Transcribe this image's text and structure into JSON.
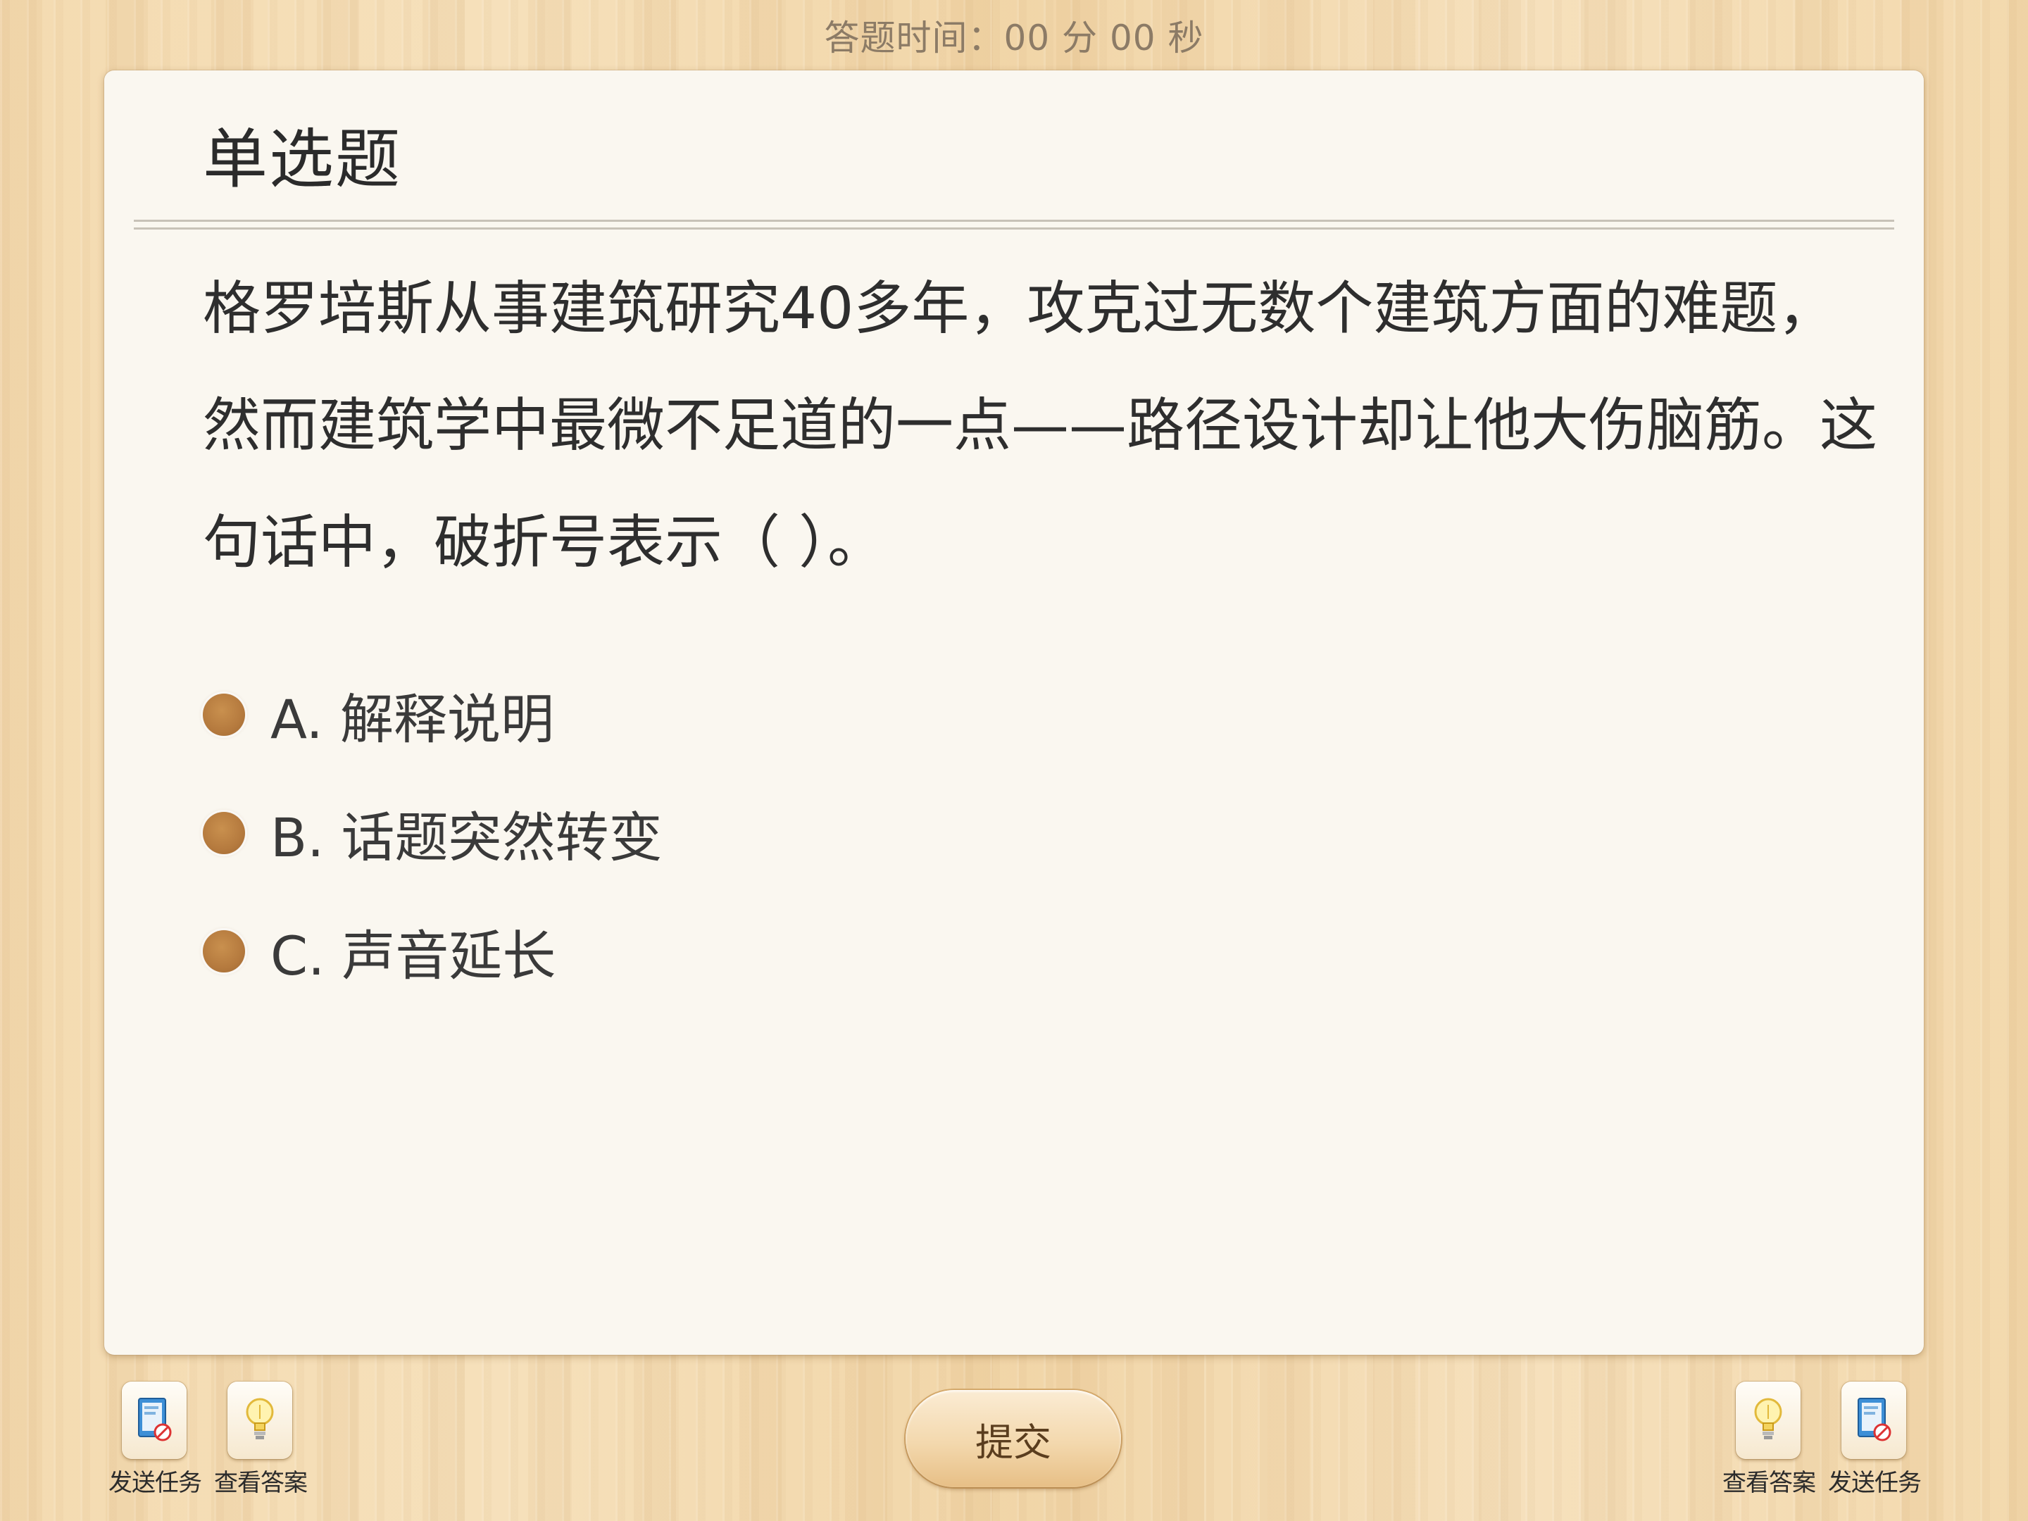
{
  "timer": {
    "label": "答题时间：",
    "minutes": "00",
    "minutes_unit": "分",
    "seconds": "00",
    "seconds_unit": "秒"
  },
  "question": {
    "type": "单选题",
    "text": "格罗培斯从事建筑研究40多年，攻克过无数个建筑方面的难题，然而建筑学中最微不足道的一点——路径设计却让他大伤脑筋。这句话中，破折号表示（ ）。",
    "options": [
      {
        "letter": "A.",
        "text": "解释说明"
      },
      {
        "letter": "B.",
        "text": "话题突然转变"
      },
      {
        "letter": "C.",
        "text": "声音延长"
      }
    ]
  },
  "footer": {
    "submit_label": "提交",
    "left_tools": [
      {
        "label": "发送任务",
        "icon": "send-task-icon"
      },
      {
        "label": "查看答案",
        "icon": "lightbulb-icon"
      }
    ],
    "right_tools": [
      {
        "label": "查看答案",
        "icon": "lightbulb-icon"
      },
      {
        "label": "发送任务",
        "icon": "send-task-icon"
      }
    ]
  },
  "colors": {
    "radio": "#b57a3e",
    "card": "#faf7f0",
    "background": "#f1d6aa"
  }
}
